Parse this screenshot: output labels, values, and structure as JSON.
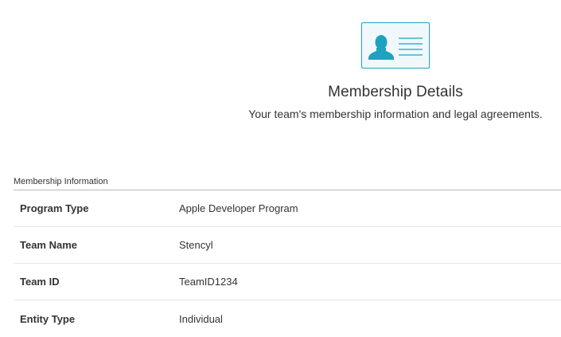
{
  "header": {
    "icon": "membership-card-icon",
    "accent_color": "#1ea2c0",
    "title": "Membership Details",
    "subtitle": "Your team's membership information and legal agreements."
  },
  "membership": {
    "section_label": "Membership Information",
    "rows": [
      {
        "label": "Program Type",
        "value": "Apple Developer Program"
      },
      {
        "label": "Team Name",
        "value": "Stencyl"
      },
      {
        "label": "Team ID",
        "value": "TeamID1234"
      },
      {
        "label": "Entity Type",
        "value": "Individual"
      }
    ]
  }
}
